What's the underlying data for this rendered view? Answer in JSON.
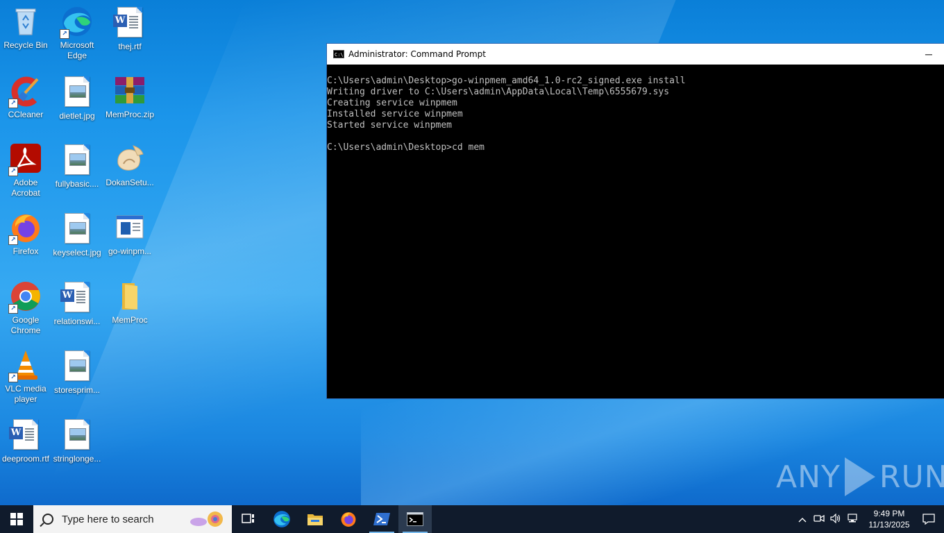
{
  "desktop_icons": [
    {
      "label": "Recycle Bin",
      "icon": "recycle-bin-icon"
    },
    {
      "label": "Microsoft Edge",
      "icon": "edge-icon"
    },
    {
      "label": "thej.rtf",
      "icon": "word-document-icon"
    },
    {
      "label": "CCleaner",
      "icon": "ccleaner-icon"
    },
    {
      "label": "dietlet.jpg",
      "icon": "image-file-icon"
    },
    {
      "label": "MemProc.zip",
      "icon": "winrar-archive-icon"
    },
    {
      "label": "Adobe Acrobat",
      "icon": "acrobat-icon"
    },
    {
      "label": "fullybasic....",
      "icon": "image-file-icon"
    },
    {
      "label": "DokanSetu...",
      "icon": "installer-icon"
    },
    {
      "label": "Firefox",
      "icon": "firefox-icon"
    },
    {
      "label": "keyselect.jpg",
      "icon": "image-file-icon"
    },
    {
      "label": "go-winpm...",
      "icon": "executable-icon"
    },
    {
      "label": "Google Chrome",
      "icon": "chrome-icon"
    },
    {
      "label": "relationswi...",
      "icon": "word-document-icon"
    },
    {
      "label": "MemProc",
      "icon": "folder-icon"
    },
    {
      "label": "VLC media player",
      "icon": "vlc-icon"
    },
    {
      "label": "storesprim...",
      "icon": "image-file-icon"
    },
    {
      "label": "deeproom.rtf",
      "icon": "word-document-icon"
    },
    {
      "label": "stringlonge...",
      "icon": "image-file-icon"
    }
  ],
  "cmd_window": {
    "title": "Administrator: Command Prompt",
    "minimize_glyph": "─",
    "lines": [
      "C:\\Users\\admin\\Desktop>go-winpmem_amd64_1.0-rc2_signed.exe install",
      "Writing driver to C:\\Users\\admin\\AppData\\Local\\Temp\\6555679.sys",
      "Creating service winpmem",
      "Installed service winpmem",
      "Started service winpmem",
      "",
      "C:\\Users\\admin\\Desktop>cd mem"
    ]
  },
  "watermark": {
    "left": "ANY",
    "right": "RUN"
  },
  "taskbar": {
    "search_placeholder": "Type here to search",
    "pinned": [
      {
        "name": "task-view-button",
        "icon": "task-view-icon"
      },
      {
        "name": "edge-taskbar-button",
        "icon": "edge-icon"
      },
      {
        "name": "file-explorer-taskbar-button",
        "icon": "folder-icon"
      },
      {
        "name": "firefox-taskbar-button",
        "icon": "firefox-icon"
      },
      {
        "name": "powershell-taskbar-button",
        "icon": "powershell-icon"
      },
      {
        "name": "cmd-taskbar-button",
        "icon": "cmd-icon"
      }
    ],
    "clock_time": "9:49 PM",
    "clock_date": "11/13/2025"
  },
  "colors": {
    "taskbar": "#101b2c",
    "accent": "#76b9ed",
    "cmd_text": "#c0c0c0"
  }
}
